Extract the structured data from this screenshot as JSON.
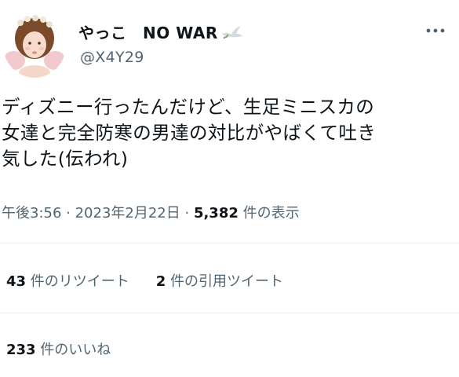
{
  "author": {
    "display_name": "やっこ　NO WAR",
    "handle": "@X4Y29",
    "avatar_icon": "cherub-angel-avatar",
    "name_emoji_icon": "dove-icon"
  },
  "tweet": {
    "text": "ディズニー行ったんだけど、生足ミニスカの\n女達と完全防寒の男達の対比がやばくて吐き\n気した(伝われ)",
    "time": "午後3:56",
    "separator": " · ",
    "date": "2023年2月22日",
    "views_count": "5,382",
    "views_label": " 件の表示"
  },
  "stats": {
    "retweets_count": "43",
    "retweets_label": " 件のリツイート",
    "quotes_count": "2",
    "quotes_label": " 件の引用ツイート",
    "likes_count": "233",
    "likes_label": " 件のいいね"
  },
  "colors": {
    "text_primary": "#0f1419",
    "text_secondary": "#536471",
    "divider": "#eff3f4"
  },
  "icons": {
    "more": "more-horizontal-icon"
  }
}
